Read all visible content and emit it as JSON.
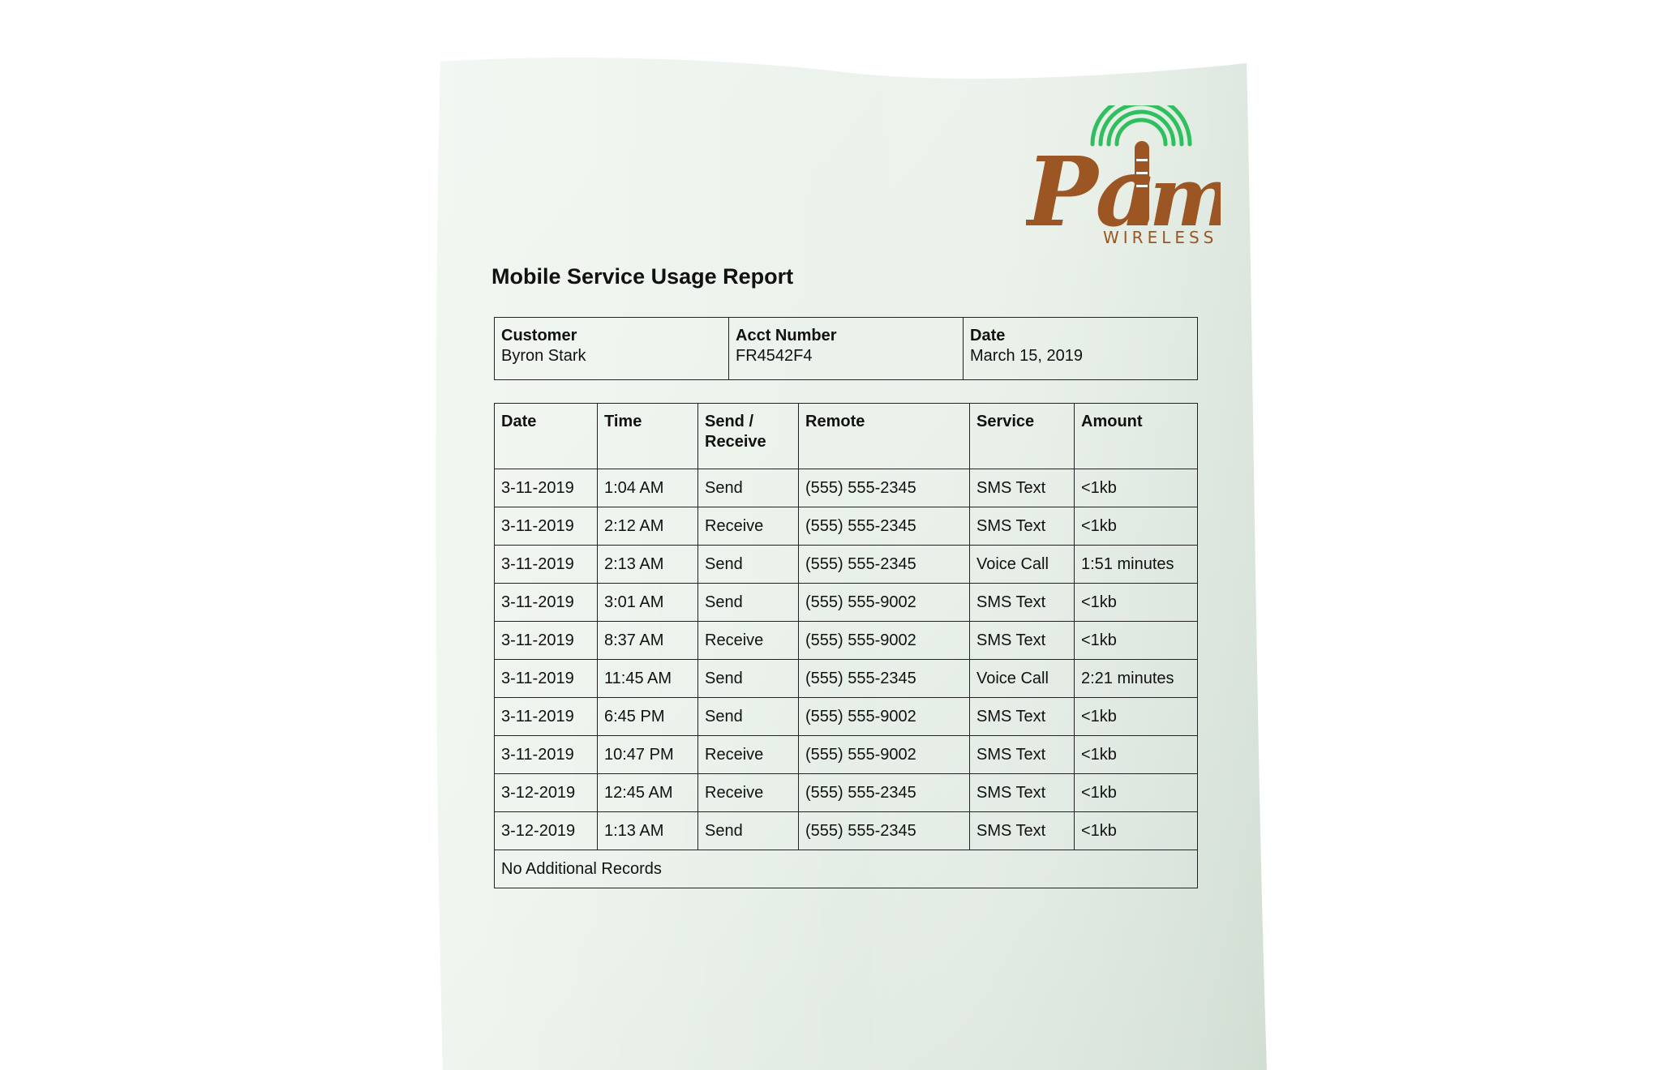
{
  "brand": {
    "logo_word": "Palm",
    "logo_sub": "WIRELESS",
    "colors": {
      "brown": "#9b5623",
      "green": "#2fbf5e"
    }
  },
  "report": {
    "title": "Mobile Service Usage Report",
    "info": [
      {
        "label": "Customer",
        "value": "Byron Stark"
      },
      {
        "label": "Acct Number",
        "value": "FR4542F4"
      },
      {
        "label": "Date",
        "value": "March 15, 2019"
      }
    ],
    "columns": [
      "Date",
      "Time",
      "Send / Receive",
      "Remote",
      "Service",
      "Amount"
    ],
    "rows": [
      [
        "3-11-2019",
        "1:04 AM",
        "Send",
        "(555) 555-2345",
        "SMS Text",
        "<1kb"
      ],
      [
        "3-11-2019",
        "2:12 AM",
        "Receive",
        "(555) 555-2345",
        "SMS Text",
        "<1kb"
      ],
      [
        "3-11-2019",
        "2:13 AM",
        "Send",
        "(555) 555-2345",
        "Voice Call",
        "1:51 minutes"
      ],
      [
        "3-11-2019",
        "3:01 AM",
        "Send",
        "(555) 555-9002",
        "SMS Text",
        "<1kb"
      ],
      [
        "3-11-2019",
        "8:37 AM",
        "Receive",
        "(555) 555-9002",
        "SMS Text",
        "<1kb"
      ],
      [
        "3-11-2019",
        "11:45 AM",
        "Send",
        "(555) 555-2345",
        "Voice Call",
        "2:21 minutes"
      ],
      [
        "3-11-2019",
        "6:45 PM",
        "Send",
        "(555) 555-9002",
        "SMS Text",
        "<1kb"
      ],
      [
        "3-11-2019",
        "10:47 PM",
        "Receive",
        "(555) 555-9002",
        "SMS Text",
        "<1kb"
      ],
      [
        "3-12-2019",
        "12:45 AM",
        "Receive",
        "(555) 555-2345",
        "SMS Text",
        "<1kb"
      ],
      [
        "3-12-2019",
        "1:13 AM",
        "Send",
        "(555) 555-2345",
        "SMS Text",
        "<1kb"
      ]
    ],
    "footer_note": "No Additional Records"
  }
}
